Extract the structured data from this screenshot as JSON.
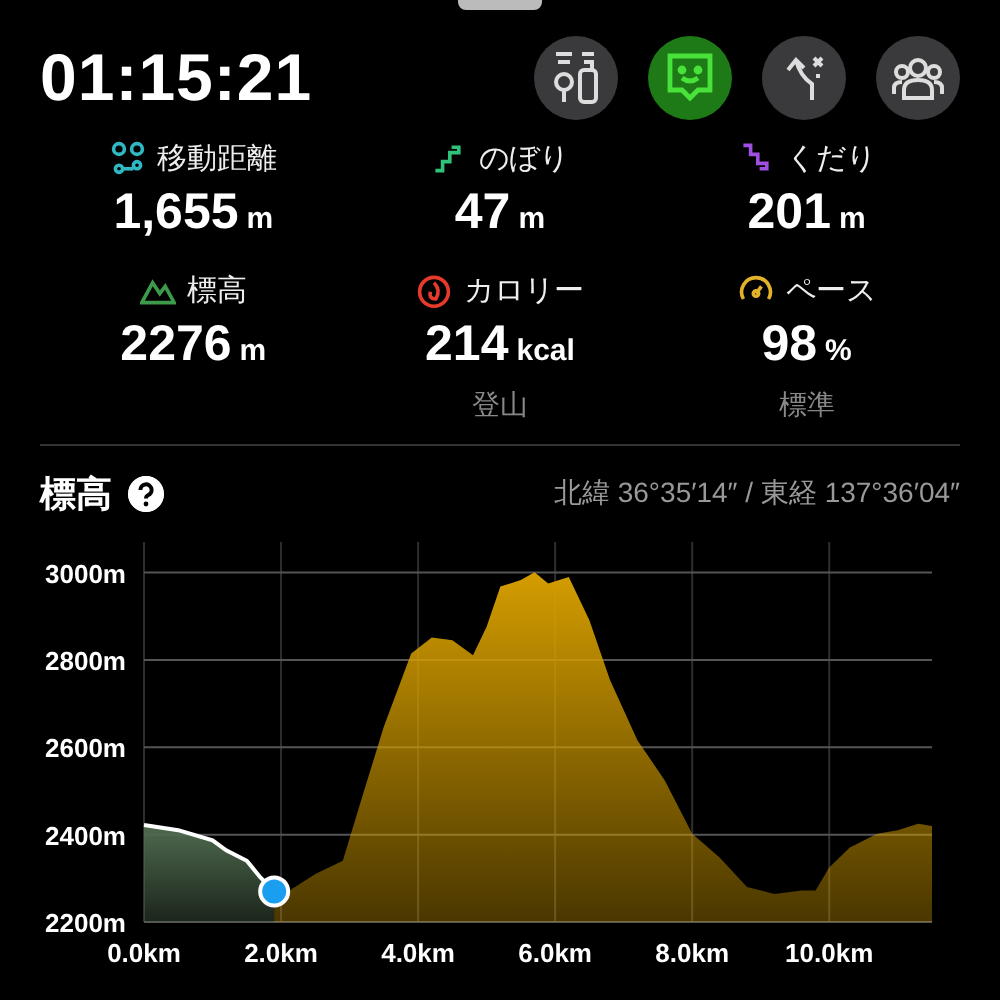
{
  "timer": "01:15:21",
  "toolbar": [
    {
      "selected": false
    },
    {
      "selected": true
    },
    {
      "selected": false
    },
    {
      "selected": false
    }
  ],
  "stats": [
    {
      "label": "移動距離",
      "value": "1,655",
      "unit": "m"
    },
    {
      "label": "のぼり",
      "value": "47",
      "unit": "m"
    },
    {
      "label": "くだり",
      "value": "201",
      "unit": "m"
    },
    {
      "label": "標高",
      "value": "2276",
      "unit": "m"
    },
    {
      "label": "カロリー",
      "value": "214",
      "unit": "kcal",
      "note": "登山"
    },
    {
      "label": "ペース",
      "value": "98",
      "unit": "%",
      "note": "標準"
    }
  ],
  "elevation": {
    "title": "標高",
    "coordinates": "北緯 36°35′14″ / 東経 137°36′04″",
    "chart_data": {
      "type": "area",
      "grid": true,
      "xlim": [
        0,
        11.5
      ],
      "ylim": [
        2200,
        3070
      ],
      "x": [
        0,
        0.5,
        1.0,
        1.2,
        1.5,
        1.7,
        1.9,
        2.5,
        2.9,
        3.2,
        3.5,
        3.9,
        4.2,
        4.5,
        4.8,
        5.0,
        5.2,
        5.5,
        5.7,
        5.9,
        6.2,
        6.5,
        6.8,
        7.2,
        7.6,
        8.0,
        8.4,
        8.8,
        9.2,
        9.6,
        9.8,
        10.0,
        10.3,
        10.7,
        11.0,
        11.3,
        11.5
      ],
      "series": [
        {
          "color": "#4f6a4f",
          "values": [
            2422,
            2410,
            2387,
            2364,
            2340,
            2302,
            2270,
            null,
            null,
            null,
            null,
            null,
            null,
            null,
            null,
            null,
            null,
            null,
            null,
            null,
            null,
            null,
            null,
            null,
            null,
            null,
            null,
            null,
            null,
            null,
            null,
            null,
            null,
            null,
            null,
            null,
            null
          ]
        },
        {
          "color": "#d49d00",
          "values": [
            null,
            null,
            null,
            null,
            null,
            null,
            2250,
            2310,
            2340,
            2494,
            2647,
            2815,
            2851,
            2845,
            2811,
            2876,
            2968,
            2983,
            3001,
            2975,
            2990,
            2891,
            2754,
            2616,
            2524,
            2402,
            2348,
            2280,
            2264,
            2272,
            2272,
            2325,
            2371,
            2402,
            2410,
            2425,
            2420
          ]
        }
      ],
      "xticks": [
        {
          "value": 0,
          "label": "0.0km"
        },
        {
          "value": 2,
          "label": "2.0km"
        },
        {
          "value": 4,
          "label": "4.0km"
        },
        {
          "value": 6,
          "label": "6.0km"
        },
        {
          "value": 8,
          "label": "8.0km"
        },
        {
          "value": 10,
          "label": "10.0km"
        }
      ],
      "yticks": [
        {
          "value": 2200,
          "label": "2200m"
        },
        {
          "value": 2400,
          "label": "2400m"
        },
        {
          "value": 2600,
          "label": "2600m"
        },
        {
          "value": 2800,
          "label": "2800m"
        },
        {
          "value": 3000,
          "label": "3000m"
        }
      ]
    }
  }
}
